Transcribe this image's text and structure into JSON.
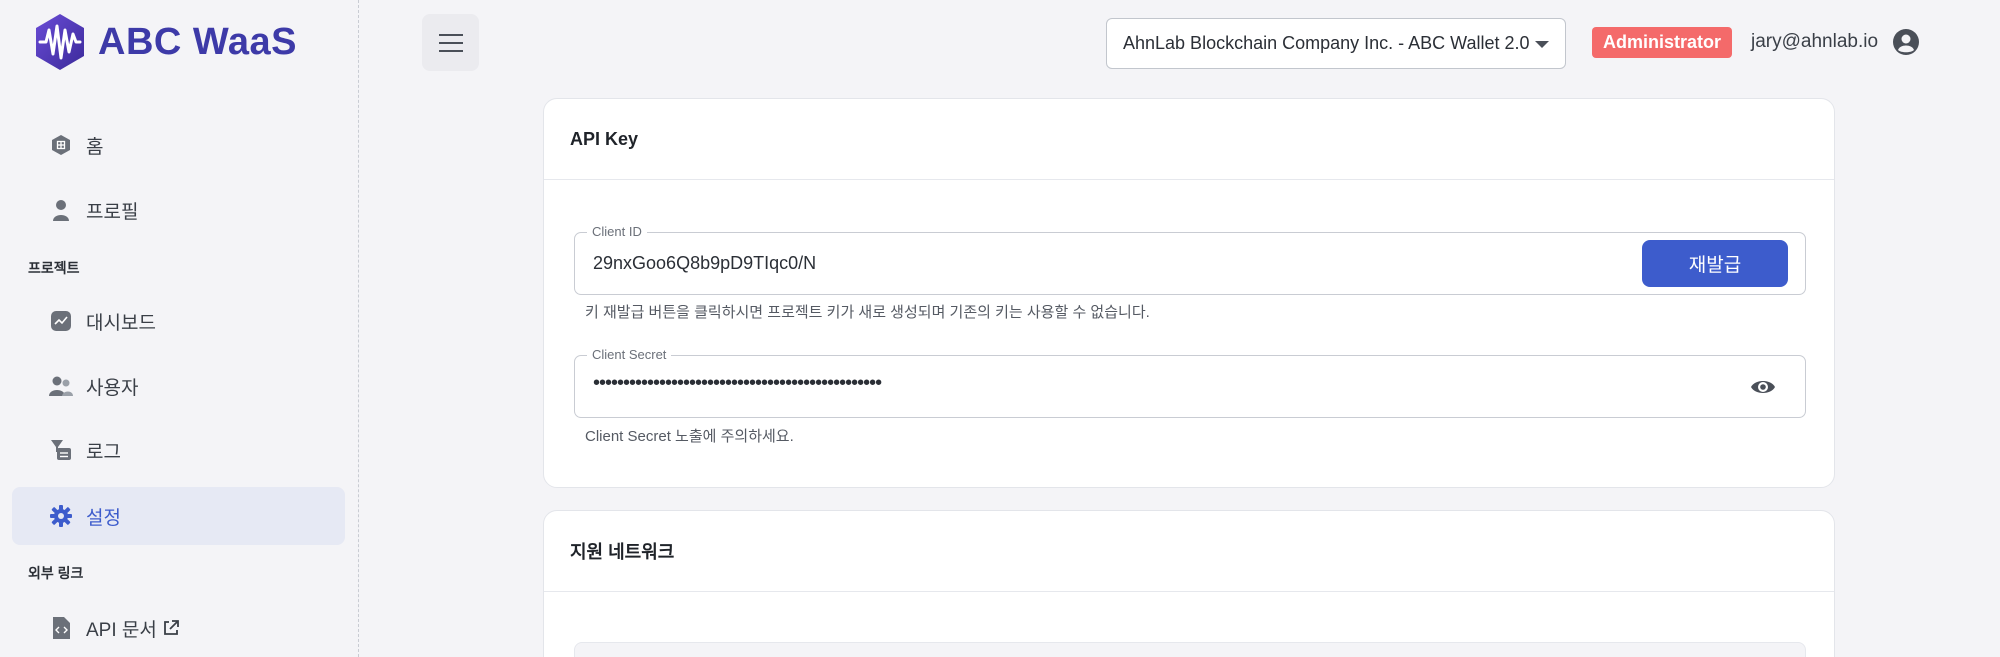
{
  "brand": {
    "name": "ABC WaaS"
  },
  "sidebar": {
    "items": [
      {
        "label": "홈",
        "icon": "home-icon"
      },
      {
        "label": "프로필",
        "icon": "person-icon"
      },
      {
        "label": "대시보드",
        "icon": "dashboard-icon"
      },
      {
        "label": "사용자",
        "icon": "users-icon"
      },
      {
        "label": "로그",
        "icon": "log-icon"
      },
      {
        "label": "설정",
        "icon": "gear-icon",
        "active": true
      },
      {
        "label": "API 문서",
        "icon": "code-doc-icon",
        "external": true
      }
    ],
    "sections": {
      "project": "프로젝트",
      "external_links": "외부 링크"
    }
  },
  "topbar": {
    "org_select": "AhnLab Blockchain Company Inc. - ABC Wallet 2.0",
    "role": "Administrator",
    "email": "jary@ahnlab.io"
  },
  "api_key": {
    "title": "API Key",
    "client_id": {
      "label": "Client ID",
      "value": "29nxGoo6Q8b9pD9TIqc0/N",
      "button": "재발급",
      "helper": "키 재발급 버튼을 클릭하시면 프로젝트 키가 새로 생성되며 기존의 키는 사용할 수 없습니다."
    },
    "client_secret": {
      "label": "Client Secret",
      "value": "••••••••••••••••••••••••••••••••••••••••••••••••",
      "helper": "Client Secret 노출에 주의하세요."
    }
  },
  "networks": {
    "title": "지원 네트워크"
  },
  "colors": {
    "accent": "#3d5ccc",
    "brand": "#3d3aa8",
    "badge": "#f46a6a"
  }
}
